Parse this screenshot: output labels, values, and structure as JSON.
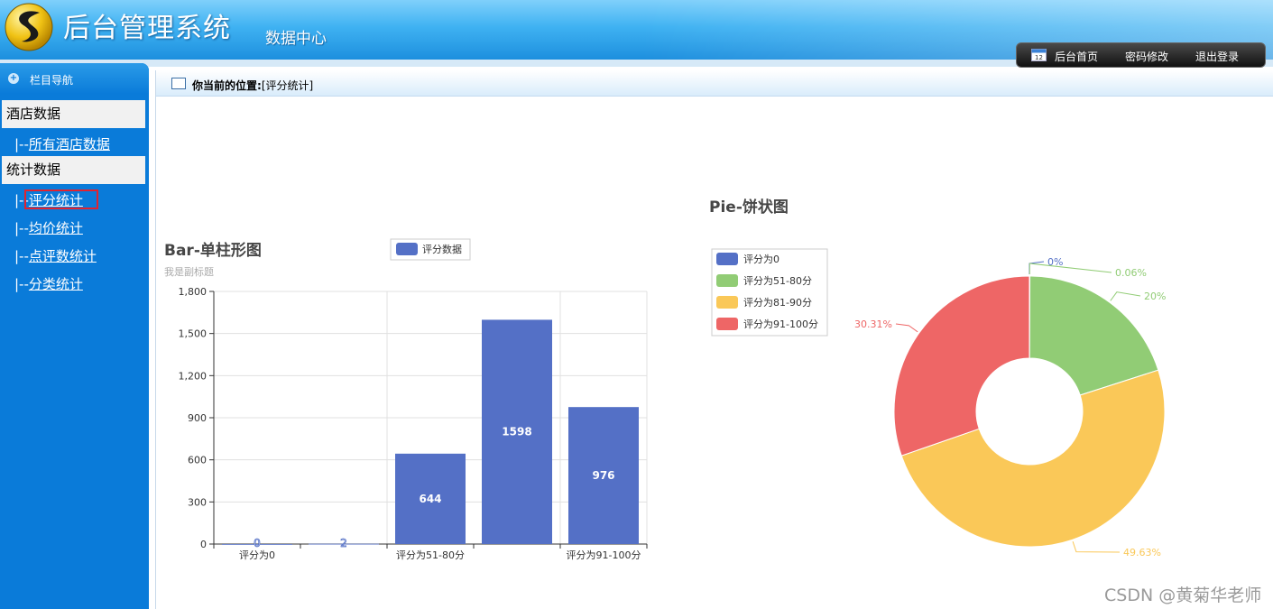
{
  "header": {
    "title": "后台管理系统",
    "subtitle": "数据中心",
    "nav": [
      "后台首页",
      "密码修改",
      "退出登录"
    ]
  },
  "sidebar": {
    "heading": "栏目导航",
    "sections": [
      {
        "label": "酒店数据",
        "items": [
          "所有酒店数据"
        ]
      },
      {
        "label": "统计数据",
        "items": [
          "评分统计",
          "均价统计",
          "点评数统计",
          "分类统计"
        ]
      }
    ],
    "prefix": "|--",
    "active_item": "评分统计"
  },
  "breadcrumb": {
    "label": "你当前的位置:",
    "value": "[评分统计]"
  },
  "colors": {
    "blue": "#5470c6",
    "green": "#91cc75",
    "yellow": "#fac858",
    "red": "#ee6666",
    "sidebar": "#0a7bd9"
  },
  "chart_data": [
    {
      "type": "bar",
      "title": "Bar-单柱形图",
      "subtitle": "我是副标题",
      "legend": [
        "评分数据"
      ],
      "categories": [
        "评分为0",
        "评分为51-80分",
        "评分为81-90分",
        "评分为91-100分"
      ],
      "shown_tick_labels": [
        "评分为0",
        "评分为51-80分",
        "评分为91-100分"
      ],
      "series": [
        {
          "name": "评分数据",
          "values": [
            0,
            2,
            644,
            1598,
            976
          ]
        }
      ],
      "values": [
        0,
        2,
        644,
        1598,
        976
      ],
      "yticks": [
        "0",
        "300",
        "600",
        "900",
        "1,200",
        "1,500",
        "1,800"
      ],
      "ylim": [
        0,
        1800
      ],
      "grid": true
    },
    {
      "type": "pie",
      "title": "Pie-饼状图",
      "legend": [
        "评分为0",
        "评分为51-80分",
        "评分为81-90分",
        "评分为91-100分"
      ],
      "slices": [
        {
          "name": "评分为0",
          "percent": 0,
          "label": "0%",
          "color": "#5470c6"
        },
        {
          "name": "",
          "percent": 0.06,
          "label": "0.06%",
          "color": "#91cc75"
        },
        {
          "name": "评分为51-80分",
          "percent": 20,
          "label": "20%",
          "color": "#91cc75"
        },
        {
          "name": "评分为81-90分",
          "percent": 49.63,
          "label": "49.63%",
          "color": "#fac858"
        },
        {
          "name": "评分为91-100分",
          "percent": 30.31,
          "label": "30.31%",
          "color": "#ee6666"
        }
      ],
      "legend_position": "top-left",
      "donut": true
    }
  ],
  "watermark": "CSDN @黄菊华老师"
}
